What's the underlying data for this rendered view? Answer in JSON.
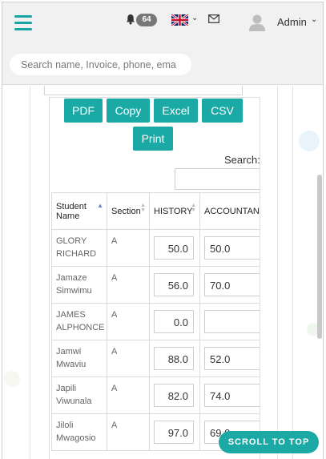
{
  "header": {
    "notification_count": "64",
    "user_name": "Admin",
    "search_placeholder": "Search name, Invoice, phone, ema"
  },
  "export_buttons": {
    "pdf": "PDF",
    "copy": "Copy",
    "excel": "Excel",
    "csv": "CSV",
    "print": "Print"
  },
  "table_search_label": "Search:",
  "table": {
    "headers": {
      "student_name": "Student Name",
      "section": "Section",
      "history": "HISTORY",
      "accountancy": "ACCOUNTANCY"
    },
    "rows": [
      {
        "name": "GLORY RICHARD",
        "section": "A",
        "history": "50.0",
        "accountancy": "50.0"
      },
      {
        "name": "Jamaze Simwimu",
        "section": "A",
        "history": "56.0",
        "accountancy": "70.0"
      },
      {
        "name": "JAMES ALPHONCE",
        "section": "A",
        "history": "0.0",
        "accountancy": ""
      },
      {
        "name": "Jamwi Mwaviu",
        "section": "A",
        "history": "88.0",
        "accountancy": "52.0"
      },
      {
        "name": "Japili Viwunala",
        "section": "A",
        "history": "82.0",
        "accountancy": "74.0"
      },
      {
        "name": "Jiloli Mwagosio",
        "section": "A",
        "history": "97.0",
        "accountancy": "69.0"
      }
    ]
  },
  "scroll_to_top": "SCROLL TO TOP",
  "colors": {
    "accent": "#1aa9a4",
    "sort_active": "#6b7fd4"
  }
}
